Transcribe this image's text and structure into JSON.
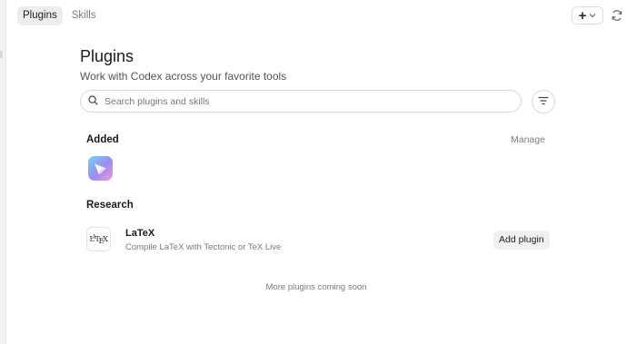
{
  "tabs": [
    {
      "label": "Plugins",
      "active": true
    },
    {
      "label": "Skills",
      "active": false
    }
  ],
  "toolbar": {
    "add_icon": "plus-icon",
    "dropdown_icon": "chevron-down-icon",
    "refresh_icon": "refresh-icon"
  },
  "page": {
    "title": "Plugins",
    "subtitle": "Work with Codex across your favorite tools"
  },
  "search": {
    "placeholder": "Search plugins and skills",
    "value": "",
    "icon": "search-icon",
    "filter_icon": "filter-icon"
  },
  "added": {
    "title": "Added",
    "manage_label": "Manage",
    "apps": [
      {
        "icon": "paper-plane-app-icon"
      }
    ]
  },
  "research": {
    "title": "Research",
    "plugins": [
      {
        "name": "LaTeX",
        "description": "Compile LaTeX with Tectonic or TeX Live",
        "button_label": "Add plugin"
      }
    ]
  },
  "footer_note": "More plugins coming soon",
  "colors": {
    "background": "#ffffff",
    "muted_text": "#7a7a7a",
    "active_tab": "#ededed",
    "button_bg": "#f0f0f0"
  }
}
